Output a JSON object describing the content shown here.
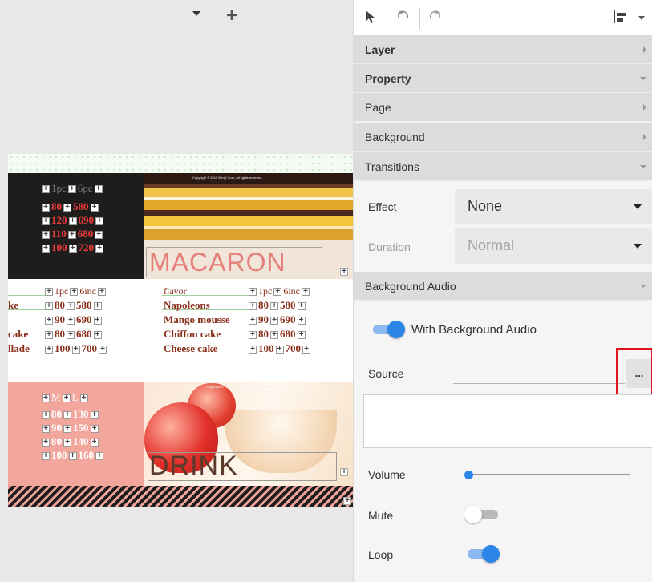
{
  "canvas": {
    "macaron": {
      "title": "MACARON",
      "copyright": "Copyright © 2015 BenQ Corp. All rights reserved.",
      "size_headers": [
        "1pc",
        "6pc"
      ],
      "prices": [
        [
          "80",
          "580"
        ],
        [
          "120",
          "690"
        ],
        [
          "110",
          "680"
        ],
        [
          "100",
          "720"
        ]
      ]
    },
    "cake": {
      "left_items": [
        "",
        "ke",
        "",
        "cake",
        "llade"
      ],
      "left_headers": [
        "1pc",
        "6inc"
      ],
      "left_prices": [
        [
          "80",
          "580"
        ],
        [
          "90",
          "690"
        ],
        [
          "80",
          "680"
        ],
        [
          "100",
          "700"
        ]
      ],
      "flavor_label": "flavor",
      "right_headers": [
        "1pc",
        "6inc"
      ],
      "items": [
        "Napoleons",
        "Mango mousse",
        "Chiffon cake",
        "Cheese cake"
      ],
      "right_prices": [
        [
          "80",
          "580"
        ],
        [
          "90",
          "690"
        ],
        [
          "80",
          "680"
        ],
        [
          "100",
          "700"
        ]
      ]
    },
    "drink": {
      "title": "DRINK",
      "copyright": "Copyright © 2015 BenQ Corp. All rights reserved.",
      "size_headers": [
        "M",
        "L"
      ],
      "prices": [
        [
          "80",
          "130"
        ],
        [
          "90",
          "150"
        ],
        [
          "80",
          "140"
        ],
        [
          "100",
          "160"
        ]
      ]
    }
  },
  "panel": {
    "toolbar": {
      "icons": [
        "pointer-icon",
        "undo-icon",
        "redo-icon",
        "align-icon",
        "dropdown-caret-icon"
      ]
    },
    "sections": {
      "layer": "Layer",
      "property": "Property",
      "page": "Page",
      "background": "Background",
      "transitions": "Transitions",
      "background_audio": "Background Audio"
    },
    "transitions": {
      "effect_label": "Effect",
      "effect_value": "None",
      "duration_label": "Duration",
      "duration_value": "Normal"
    },
    "audio": {
      "with_audio_label": "With Background Audio",
      "with_audio_on": true,
      "source_label": "Source",
      "browse_label": "...",
      "volume_label": "Volume",
      "volume_level": 0.02,
      "mute_label": "Mute",
      "mute_on": false,
      "loop_label": "Loop",
      "loop_on": true
    }
  },
  "colors": {
    "accent": "#2c86e8",
    "highlight": "#e0141a",
    "header_bg": "#dcdcdc"
  }
}
